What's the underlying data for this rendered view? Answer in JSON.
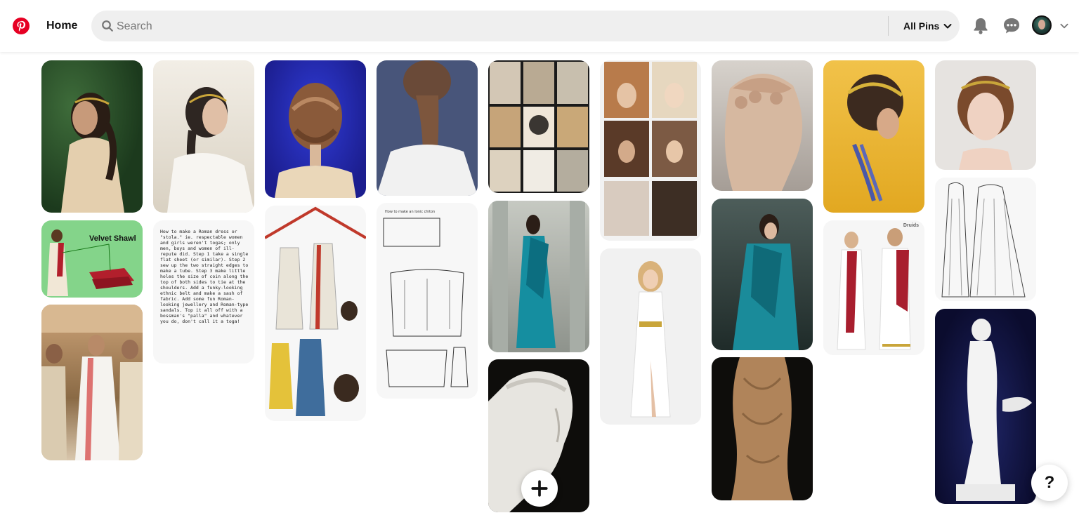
{
  "header": {
    "home_label": "Home",
    "search_placeholder": "Search",
    "filter_label": "All Pins"
  },
  "colors": {
    "brand": "#e60023",
    "search_bg": "#efefef"
  },
  "icons": [
    "pinterest-logo-icon",
    "search-icon",
    "chevron-down-icon",
    "bell-icon",
    "chat-bubble-icon",
    "avatar",
    "plus-icon",
    "help-icon"
  ],
  "pins": {
    "velvet_shawl": "Velvet Shawl",
    "roman_dress_note": "How to make a Roman dress or \"stola.\" ie. respectable women and girls weren't togas; only men, boys and women of ill-repute did. Step 1 take a single flat sheet (or similar). Step 2 sew up the two straight edges to make a tube. Step 3 make little holes the size of coin along the top of both sides to tie at the shoulders. Add a funky-looking ethnic belt and make a sash of fabric. Add some fun Roman-looking jewellery and Roman-type sandals. Top it all off with a bossman's \"palla\" and whatever you do, don't call it a toga!",
    "chiton_title": "How to make an Ionic chiton",
    "costume_brand": "Druids"
  },
  "help_label": "?"
}
